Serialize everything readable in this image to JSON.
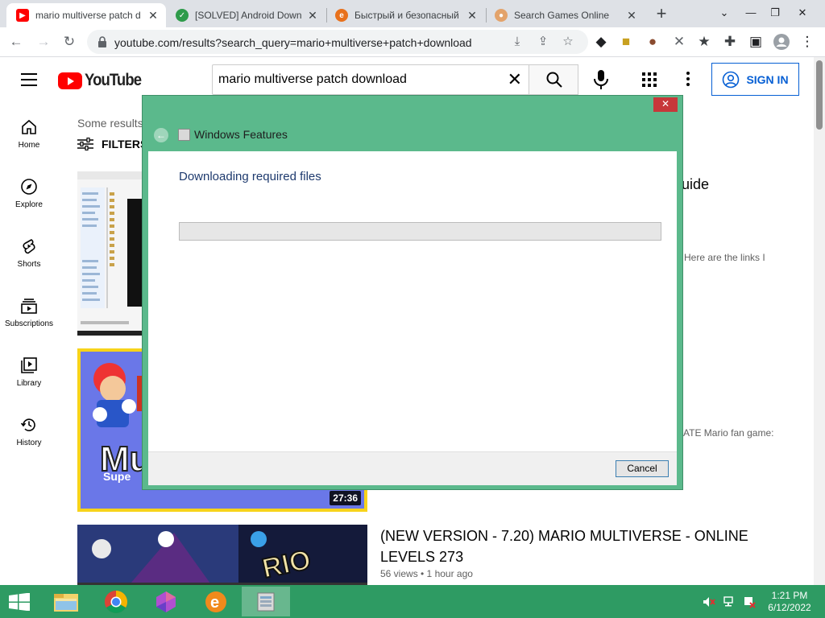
{
  "browser": {
    "tabs": [
      {
        "title": "mario multiverse patch d",
        "favicon": "youtube-icon",
        "active": true
      },
      {
        "title": "[SOLVED] Android Down",
        "favicon": "green-check-icon",
        "active": false
      },
      {
        "title": "Быстрый и безопасный",
        "favicon": "e-browser-icon",
        "active": false
      },
      {
        "title": "Search Games Online",
        "favicon": "person-icon",
        "active": false
      }
    ],
    "new_tab": "+",
    "url": "youtube.com/results?search_query=mario+multiverse+patch+download"
  },
  "youtube": {
    "logo_text": "YouTube",
    "search_query": "mario multiverse patch download",
    "sign_in": "SIGN IN",
    "nav": [
      {
        "label": "Home",
        "icon": "home-icon"
      },
      {
        "label": "Explore",
        "icon": "compass-icon"
      },
      {
        "label": "Shorts",
        "icon": "shorts-icon"
      },
      {
        "label": "Subscriptions",
        "icon": "subscriptions-icon"
      },
      {
        "label": "Library",
        "icon": "library-icon"
      },
      {
        "label": "History",
        "icon": "history-icon"
      }
    ],
    "results_header": "Some results",
    "filters_label": "FILTERS",
    "videos": [
      {
        "title_fragment": "uide",
        "desc_fragment": "Here are the links I"
      },
      {
        "duration": "27:36",
        "desc_fragment": "ATE Mario fan game:"
      },
      {
        "title": "(NEW VERSION - 7.20) MARIO MULTIVERSE - ONLINE LEVELS 273",
        "meta": "56 views • 1 hour ago"
      }
    ]
  },
  "dialog": {
    "title": "Windows Features",
    "heading": "Downloading required files",
    "progress": 0,
    "cancel": "Cancel",
    "close_glyph": "✕"
  },
  "taskbar": {
    "time": "1:21 PM",
    "date": "6/12/2022",
    "apps": [
      "file-explorer-icon",
      "chrome-icon",
      "polygon-app-icon",
      "e-browser-icon",
      "windows-features-icon"
    ]
  },
  "colors": {
    "dialog_frame": "#5bb98c",
    "taskbar": "#2e9b63",
    "youtube_red": "#ff0000",
    "signin_blue": "#065fd4"
  }
}
